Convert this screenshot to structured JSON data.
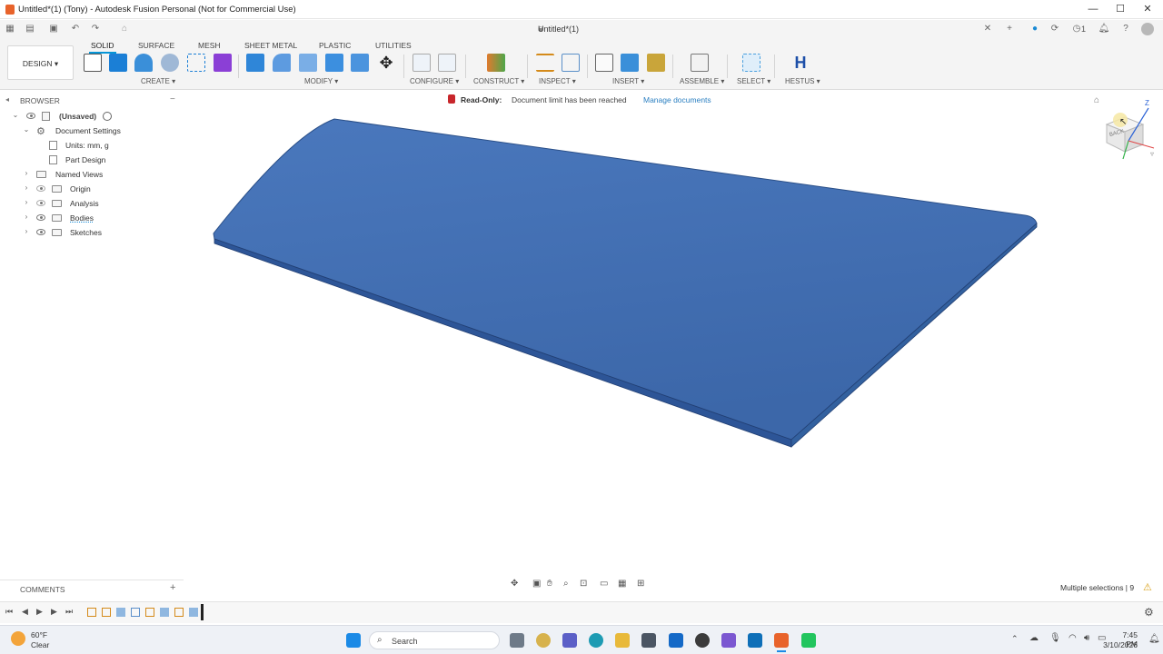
{
  "window": {
    "title": "Untitled*(1) (Tony) - Autodesk Fusion Personal (Not for Commercial Use)",
    "minimize": "—",
    "maximize": "☐",
    "close": "✕"
  },
  "quick_access": {
    "document_tab": "Untitled*(1)",
    "job_count": "1",
    "icons": [
      "grid-icon",
      "file-icon",
      "save-icon",
      "undo-icon",
      "redo-icon",
      "home-icon",
      "close-icon",
      "plus-icon",
      "help-icon",
      "notifications-icon",
      "account-icon"
    ]
  },
  "ribbon": {
    "workspace": "DESIGN ▾",
    "tabs": [
      "SOLID",
      "SURFACE",
      "MESH",
      "SHEET METAL",
      "PLASTIC",
      "UTILITIES"
    ],
    "active_tab": "SOLID",
    "groups": [
      "CREATE ▾",
      "MODIFY ▾",
      "CONFIGURE ▾",
      "CONSTRUCT ▾",
      "INSPECT ▾",
      "INSERT ▾",
      "ASSEMBLE ▾",
      "SELECT ▾",
      "HESTUS ▾"
    ],
    "colors": {
      "accent": "#0696d7",
      "create": "#1b7fd6",
      "purple": "#8b3fd6"
    }
  },
  "browser": {
    "title": "BROWSER",
    "collapse": "−",
    "root": "(Unsaved)",
    "items": [
      {
        "label": "Document Settings",
        "expanded": true
      },
      {
        "label": "Units: mm, g"
      },
      {
        "label": "Part Design"
      },
      {
        "label": "Named Views"
      },
      {
        "label": "Origin"
      },
      {
        "label": "Analysis"
      },
      {
        "label": "Bodies"
      },
      {
        "label": "Sketches"
      }
    ]
  },
  "banner": {
    "readonly_label": "Read-Only:",
    "message": "Document limit has been reached",
    "link": "Manage documents"
  },
  "viewcube": {
    "face": "BACK",
    "axis_z": "Z"
  },
  "comments": {
    "label": "COMMENTS",
    "add": "+"
  },
  "status": {
    "selection": "Multiple selections | 9"
  },
  "taskbar": {
    "weather_temp": "60°F",
    "weather_text": "Clear",
    "search": "Search",
    "time": "7:45 PM",
    "date": "3/10/2026"
  },
  "colors": {
    "body": "#3f6fb5",
    "body_edge": "#2a4f88"
  }
}
